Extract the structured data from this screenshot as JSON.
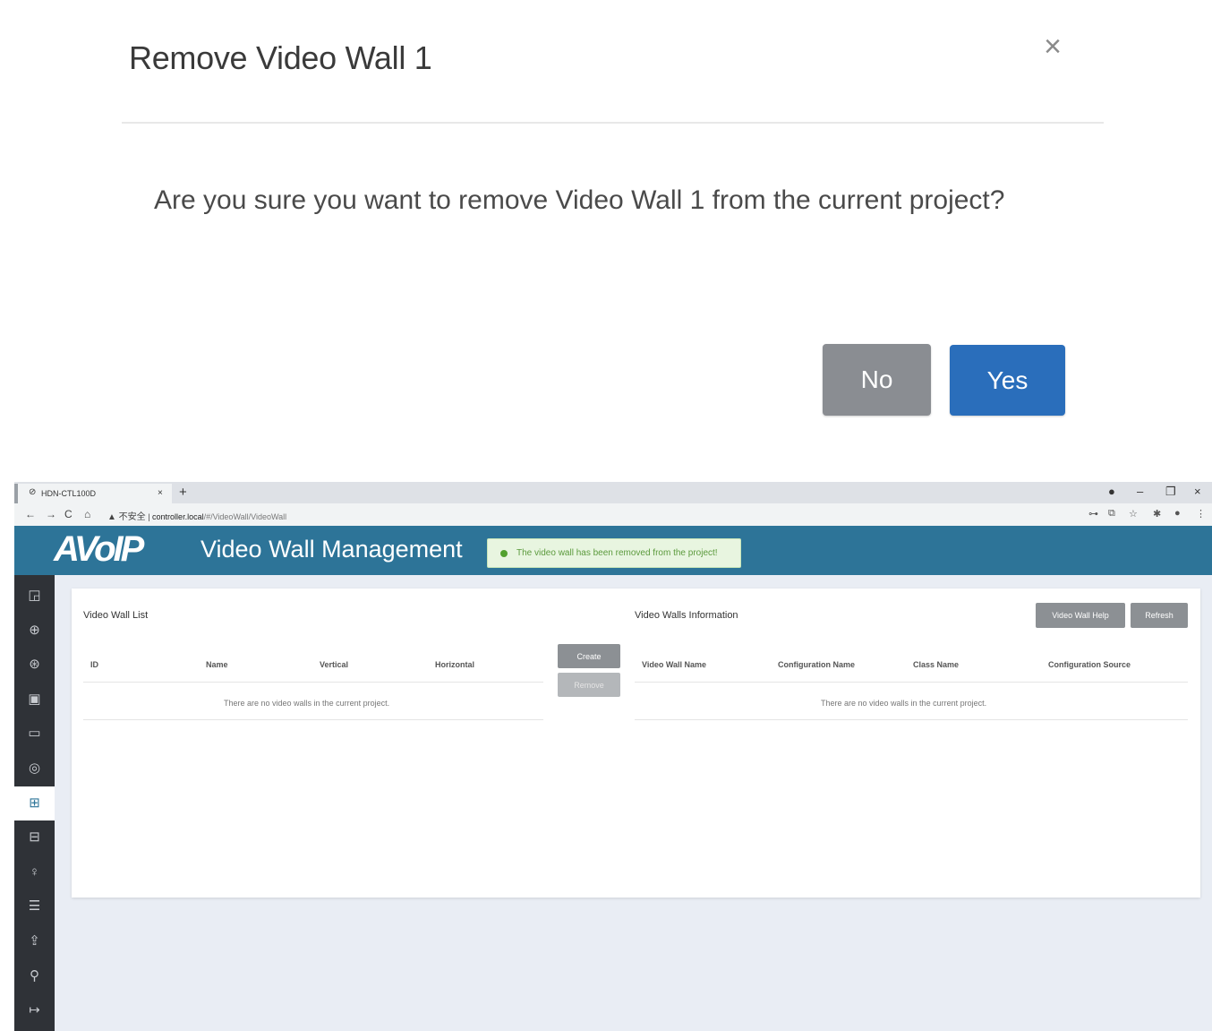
{
  "modal": {
    "title": "Remove Video Wall 1",
    "close_symbol": "×",
    "message": "Are you sure you want to remove Video Wall 1 from the current project?",
    "no_label": "No",
    "yes_label": "Yes",
    "colors": {
      "no_button": "#8a8d92",
      "yes_button": "#2a6ebb"
    }
  },
  "browser": {
    "tab_title": "HDN-CTL100D",
    "tab_close": "×",
    "new_tab": "+",
    "window_controls": {
      "record": "●",
      "minimize": "–",
      "restore": "❐",
      "close": "×"
    },
    "nav": {
      "back": "←",
      "forward": "→",
      "reload": "C",
      "home": "⌂"
    },
    "url_warning": "▲ 不安全",
    "url_host": "controller.local",
    "url_path": "/#/VideoWall/VideoWall",
    "extensions": {
      "key": "⊶",
      "translate": "⧉",
      "star": "☆",
      "puzzle": "✱",
      "profile": "●",
      "menu": "⋮"
    }
  },
  "app": {
    "logo": "AVoIP",
    "page_title": "Video Wall Management",
    "toast": "The video wall has been removed from the project!",
    "colors": {
      "header": "#2d7498",
      "sidebar": "#2f3237",
      "toast_bg": "#e8f5e0",
      "toast_text": "#5b9a3c"
    },
    "sidebar_icons": [
      "dashboard-icon",
      "globe-icon",
      "layers-icon",
      "monitor-icon",
      "display-icon",
      "fingerprint-icon",
      "video-wall-icon",
      "grid-icon",
      "user-icon",
      "sliders-icon",
      "upload-icon",
      "wrench-icon",
      "logout-icon"
    ],
    "sidebar_glyphs": [
      "◲",
      "⊕",
      "⊛",
      "▣",
      "▭",
      "◎",
      "⊞",
      "⊟",
      "♀",
      "☰",
      "⇪",
      "⚲",
      "↦"
    ],
    "active_sidebar_index": 6
  },
  "video_wall_list": {
    "heading": "Video Wall List",
    "columns": [
      "ID",
      "Name",
      "Vertical",
      "Horizontal"
    ],
    "empty_message": "There are no video walls in the current project.",
    "create_label": "Create",
    "remove_label": "Remove"
  },
  "video_walls_info": {
    "heading": "Video Walls Information",
    "help_label": "Video Wall Help",
    "refresh_label": "Refresh",
    "columns": [
      "Video Wall Name",
      "Configuration Name",
      "Class Name",
      "Configuration Source"
    ],
    "empty_message": "There are no video walls in the current project."
  }
}
